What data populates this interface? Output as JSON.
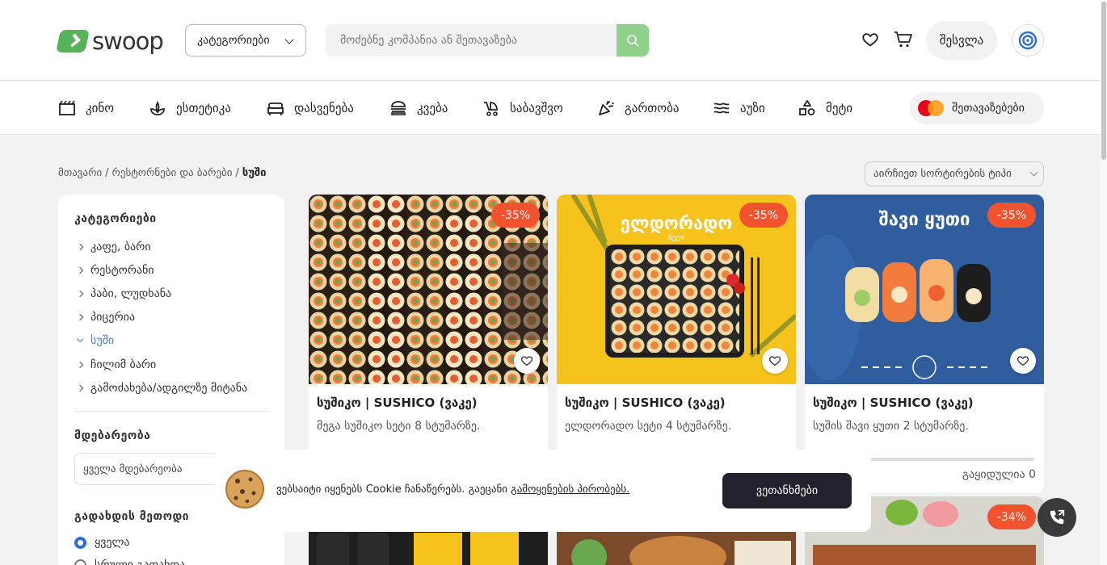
{
  "header": {
    "logo_text": "swoop",
    "categories_button": "კატეგორიები",
    "search_placeholder": "მოძებნე კომპანია ან შეთავაზება",
    "login_button": "შესვლა"
  },
  "nav": {
    "items": [
      {
        "label": "კინო",
        "icon": "cinema-icon"
      },
      {
        "label": "ესთეტიკა",
        "icon": "aesthetics-icon"
      },
      {
        "label": "დასვენება",
        "icon": "bed-icon"
      },
      {
        "label": "კვება",
        "icon": "burger-icon"
      },
      {
        "label": "საბავშვო",
        "icon": "stroller-icon"
      },
      {
        "label": "გართობა",
        "icon": "party-icon"
      },
      {
        "label": "აუზი",
        "icon": "pool-icon"
      },
      {
        "label": "მეტი",
        "icon": "shapes-icon"
      }
    ],
    "offers_button": "შეთავაზებები"
  },
  "breadcrumb": {
    "home": "მთავარი",
    "sep1": "/",
    "restaurants": "რესტორნები და ბარები",
    "sep2": "/",
    "current": "სუში"
  },
  "sort": {
    "placeholder": "აირჩიეთ სორტირების ტიპი"
  },
  "sidebar": {
    "categories_title": "კატეგორიები",
    "categories": [
      {
        "label": "კაფე, ბარი"
      },
      {
        "label": "რესტორანი"
      },
      {
        "label": "პაბი, ლუდხანა"
      },
      {
        "label": "პიცერია"
      },
      {
        "label": "სუში",
        "active": true
      },
      {
        "label": "ჩილიმ ბარი"
      },
      {
        "label": "გამოძახება/ადგილზე მიტანა"
      }
    ],
    "location_title": "მდებარეობა",
    "location_select": "ყველა მდებარეობა",
    "payment_title": "გადახდის მეთოდი",
    "payment_options": [
      {
        "label": "ყველა",
        "selected": true
      },
      {
        "label": "სრული გადახდა",
        "selected": false
      }
    ]
  },
  "offers": [
    {
      "discount": "-35%",
      "title": "სუშიკო | SUSHICO (ვაკე)",
      "description": "მეგა სუშიკო სეტი 8 სტუმარზე."
    },
    {
      "discount": "-35%",
      "title": "სუშიკო | SUSHICO (ვაკე)",
      "description": "ელდორადო სეტი 4 სტუმარზე.",
      "image_text": "ელდორადო",
      "image_subtext": "სეტი"
    },
    {
      "discount": "-35%",
      "title": "სუშიკო | SUSHICO (ვაკე)",
      "description": "სუშის შავი ყუთი 2 სტუმარზე.",
      "image_text": "შავი ყუთი",
      "sold_label": "გაყიდულია 0",
      "progress": 0
    },
    {
      "discount": "-34%"
    }
  ],
  "cookie": {
    "text_before": "ვებსაიტი იყენებს Cookie ჩანაწერებს. გაეცანი ",
    "link": "გამოყენების პირობებს.",
    "accept_button": "ვეთანხმები"
  },
  "colors": {
    "brand_green": "#57b35b",
    "search_btn": "#8fd18a",
    "badge": "#f2522e",
    "active_link": "#4a7cc7",
    "dark_button": "#20232b"
  }
}
